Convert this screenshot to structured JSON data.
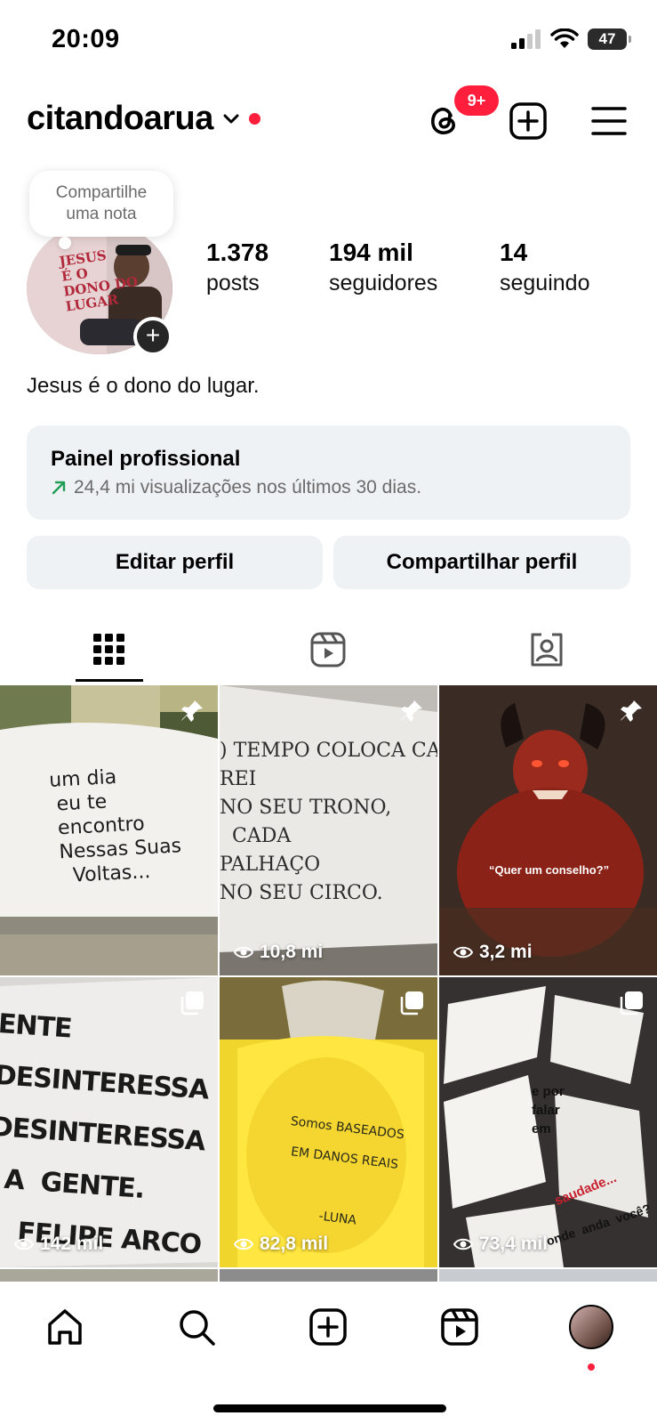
{
  "status_bar": {
    "time": "20:09",
    "battery": "47"
  },
  "header": {
    "username": "citandoarua",
    "notif_badge": "9+"
  },
  "note": {
    "text_line1": "Compartilhe",
    "text_line2": "uma nota"
  },
  "avatar_text": "JESUS\nÉ O\nDONO DO\nLUGAR",
  "stats": [
    {
      "num": "1.378",
      "label": "posts"
    },
    {
      "num": "194 mil",
      "label": "seguidores"
    },
    {
      "num": "14",
      "label": "seguindo"
    }
  ],
  "bio": "Jesus é o dono do lugar.",
  "pro_panel": {
    "title": "Painel profissional",
    "subtitle": "24,4 mi visualizações nos últimos 30 dias."
  },
  "buttons": {
    "edit": "Editar perfil",
    "share": "Compartilhar perfil"
  },
  "tiles": [
    {
      "text": "um dia\n eu te\n encontro\n Nessas Suas\n   Voltas...",
      "pinned": true,
      "views": ""
    },
    {
      "text": ") TEMPO COLOCA CAD\nREI\nNO SEU TRONO,\n  CADA\nPALHAÇO\nNO SEU CIRCO.",
      "pinned": true,
      "views": "10,8 mi"
    },
    {
      "text": "“Quer um conselho?”",
      "pinned": true,
      "views": "3,2 mi"
    },
    {
      "text": "ENTE\nDESINTERESSA\nDESINTERESSA\n  A  GENTE.\n    FELIPE ARCO",
      "pinned": false,
      "views": "142 mil"
    },
    {
      "text": "Somos BASEADOS\n EM DANOS REAIS\n\n          -LUNA",
      "pinned": false,
      "views": "82,8 mil"
    },
    {
      "text": "e por\nfalar\nem",
      "text2": "saudade...",
      "text3": "onde  anda  você?",
      "pinned": false,
      "views": "73,4 mil"
    }
  ],
  "colors": {
    "accent_red": "#ff1f3d",
    "trend_green": "#1f9d55",
    "panel_bg": "#eff2f5"
  }
}
